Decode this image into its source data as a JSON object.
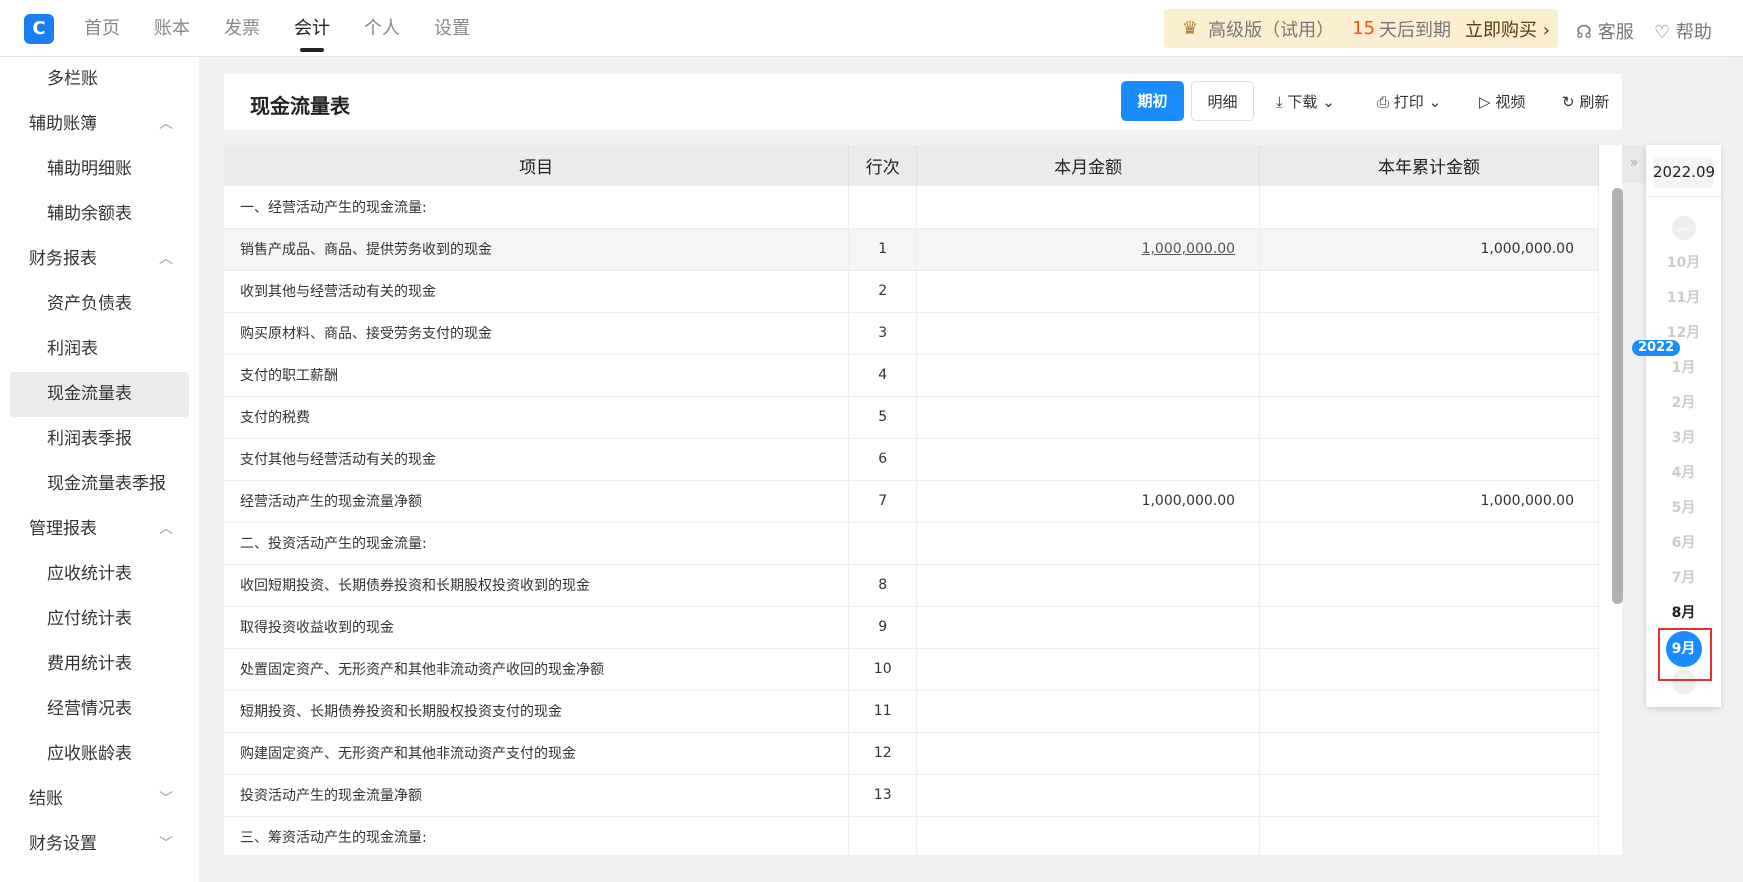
{
  "nav": {
    "items": [
      "首页",
      "账本",
      "发票",
      "会计",
      "个人",
      "设置"
    ],
    "active": 3
  },
  "promo": {
    "edition": "高级版（试用）",
    "days": "15",
    "days_suffix": "天后到期",
    "buy": "立即购买 ›"
  },
  "header_right": {
    "service": "客服",
    "help": "帮助"
  },
  "sidebar": [
    {
      "label": "多栏账",
      "type": "sub"
    },
    {
      "label": "辅助账簿",
      "type": "grp",
      "chev": "︿"
    },
    {
      "label": "辅助明细账",
      "type": "sub"
    },
    {
      "label": "辅助余额表",
      "type": "sub"
    },
    {
      "label": "财务报表",
      "type": "grp",
      "chev": "︿"
    },
    {
      "label": "资产负债表",
      "type": "sub"
    },
    {
      "label": "利润表",
      "type": "sub"
    },
    {
      "label": "现金流量表",
      "type": "act"
    },
    {
      "label": "利润表季报",
      "type": "sub"
    },
    {
      "label": "现金流量表季报",
      "type": "sub"
    },
    {
      "label": "管理报表",
      "type": "grp",
      "chev": "︿"
    },
    {
      "label": "应收统计表",
      "type": "sub"
    },
    {
      "label": "应付统计表",
      "type": "sub"
    },
    {
      "label": "费用统计表",
      "type": "sub"
    },
    {
      "label": "经营情况表",
      "type": "sub"
    },
    {
      "label": "应收账龄表",
      "type": "sub"
    },
    {
      "label": "结账",
      "type": "grp",
      "chev": "﹀"
    },
    {
      "label": "财务设置",
      "type": "grp",
      "chev": "﹀"
    }
  ],
  "page": {
    "title": "现金流量表",
    "btn_opening": "期初",
    "btn_detail": "明细",
    "download": "下载",
    "print": "打印",
    "video": "视频",
    "refresh": "刷新"
  },
  "table": {
    "headers": [
      "项目",
      "行次",
      "本月金额",
      "本年累计金额"
    ],
    "rows": [
      [
        "一、经营活动产生的现金流量:",
        "",
        "",
        ""
      ],
      [
        "销售产成品、商品、提供劳务收到的现金",
        "1",
        "1,000,000.00",
        "1,000,000.00"
      ],
      [
        "收到其他与经营活动有关的现金",
        "2",
        "",
        ""
      ],
      [
        "购买原材料、商品、接受劳务支付的现金",
        "3",
        "",
        ""
      ],
      [
        "支付的职工薪酬",
        "4",
        "",
        ""
      ],
      [
        "支付的税费",
        "5",
        "",
        ""
      ],
      [
        "支付其他与经营活动有关的现金",
        "6",
        "",
        ""
      ],
      [
        "经营活动产生的现金流量净额",
        "7",
        "1,000,000.00",
        "1,000,000.00"
      ],
      [
        "二、投资活动产生的现金流量:",
        "",
        "",
        ""
      ],
      [
        "收回短期投资、长期债券投资和长期股权投资收到的现金",
        "8",
        "",
        ""
      ],
      [
        "取得投资收益收到的现金",
        "9",
        "",
        ""
      ],
      [
        "处置固定资产、无形资产和其他非流动资产收回的现金净额",
        "10",
        "",
        ""
      ],
      [
        "短期投资、长期债券投资和长期股权投资支付的现金",
        "11",
        "",
        ""
      ],
      [
        "购建固定资产、无形资产和其他非流动资产支付的现金",
        "12",
        "",
        ""
      ],
      [
        "投资活动产生的现金流量净额",
        "13",
        "",
        ""
      ],
      [
        "三、筹资活动产生的现金流量:",
        "",
        "",
        ""
      ]
    ]
  },
  "period": {
    "current": "2022.09",
    "year_badge": "2022",
    "months": [
      "10月",
      "11月",
      "12月",
      "1月",
      "2月",
      "3月",
      "4月",
      "5月",
      "6月",
      "7月",
      "8月",
      "9月"
    ],
    "selected": "9月"
  }
}
